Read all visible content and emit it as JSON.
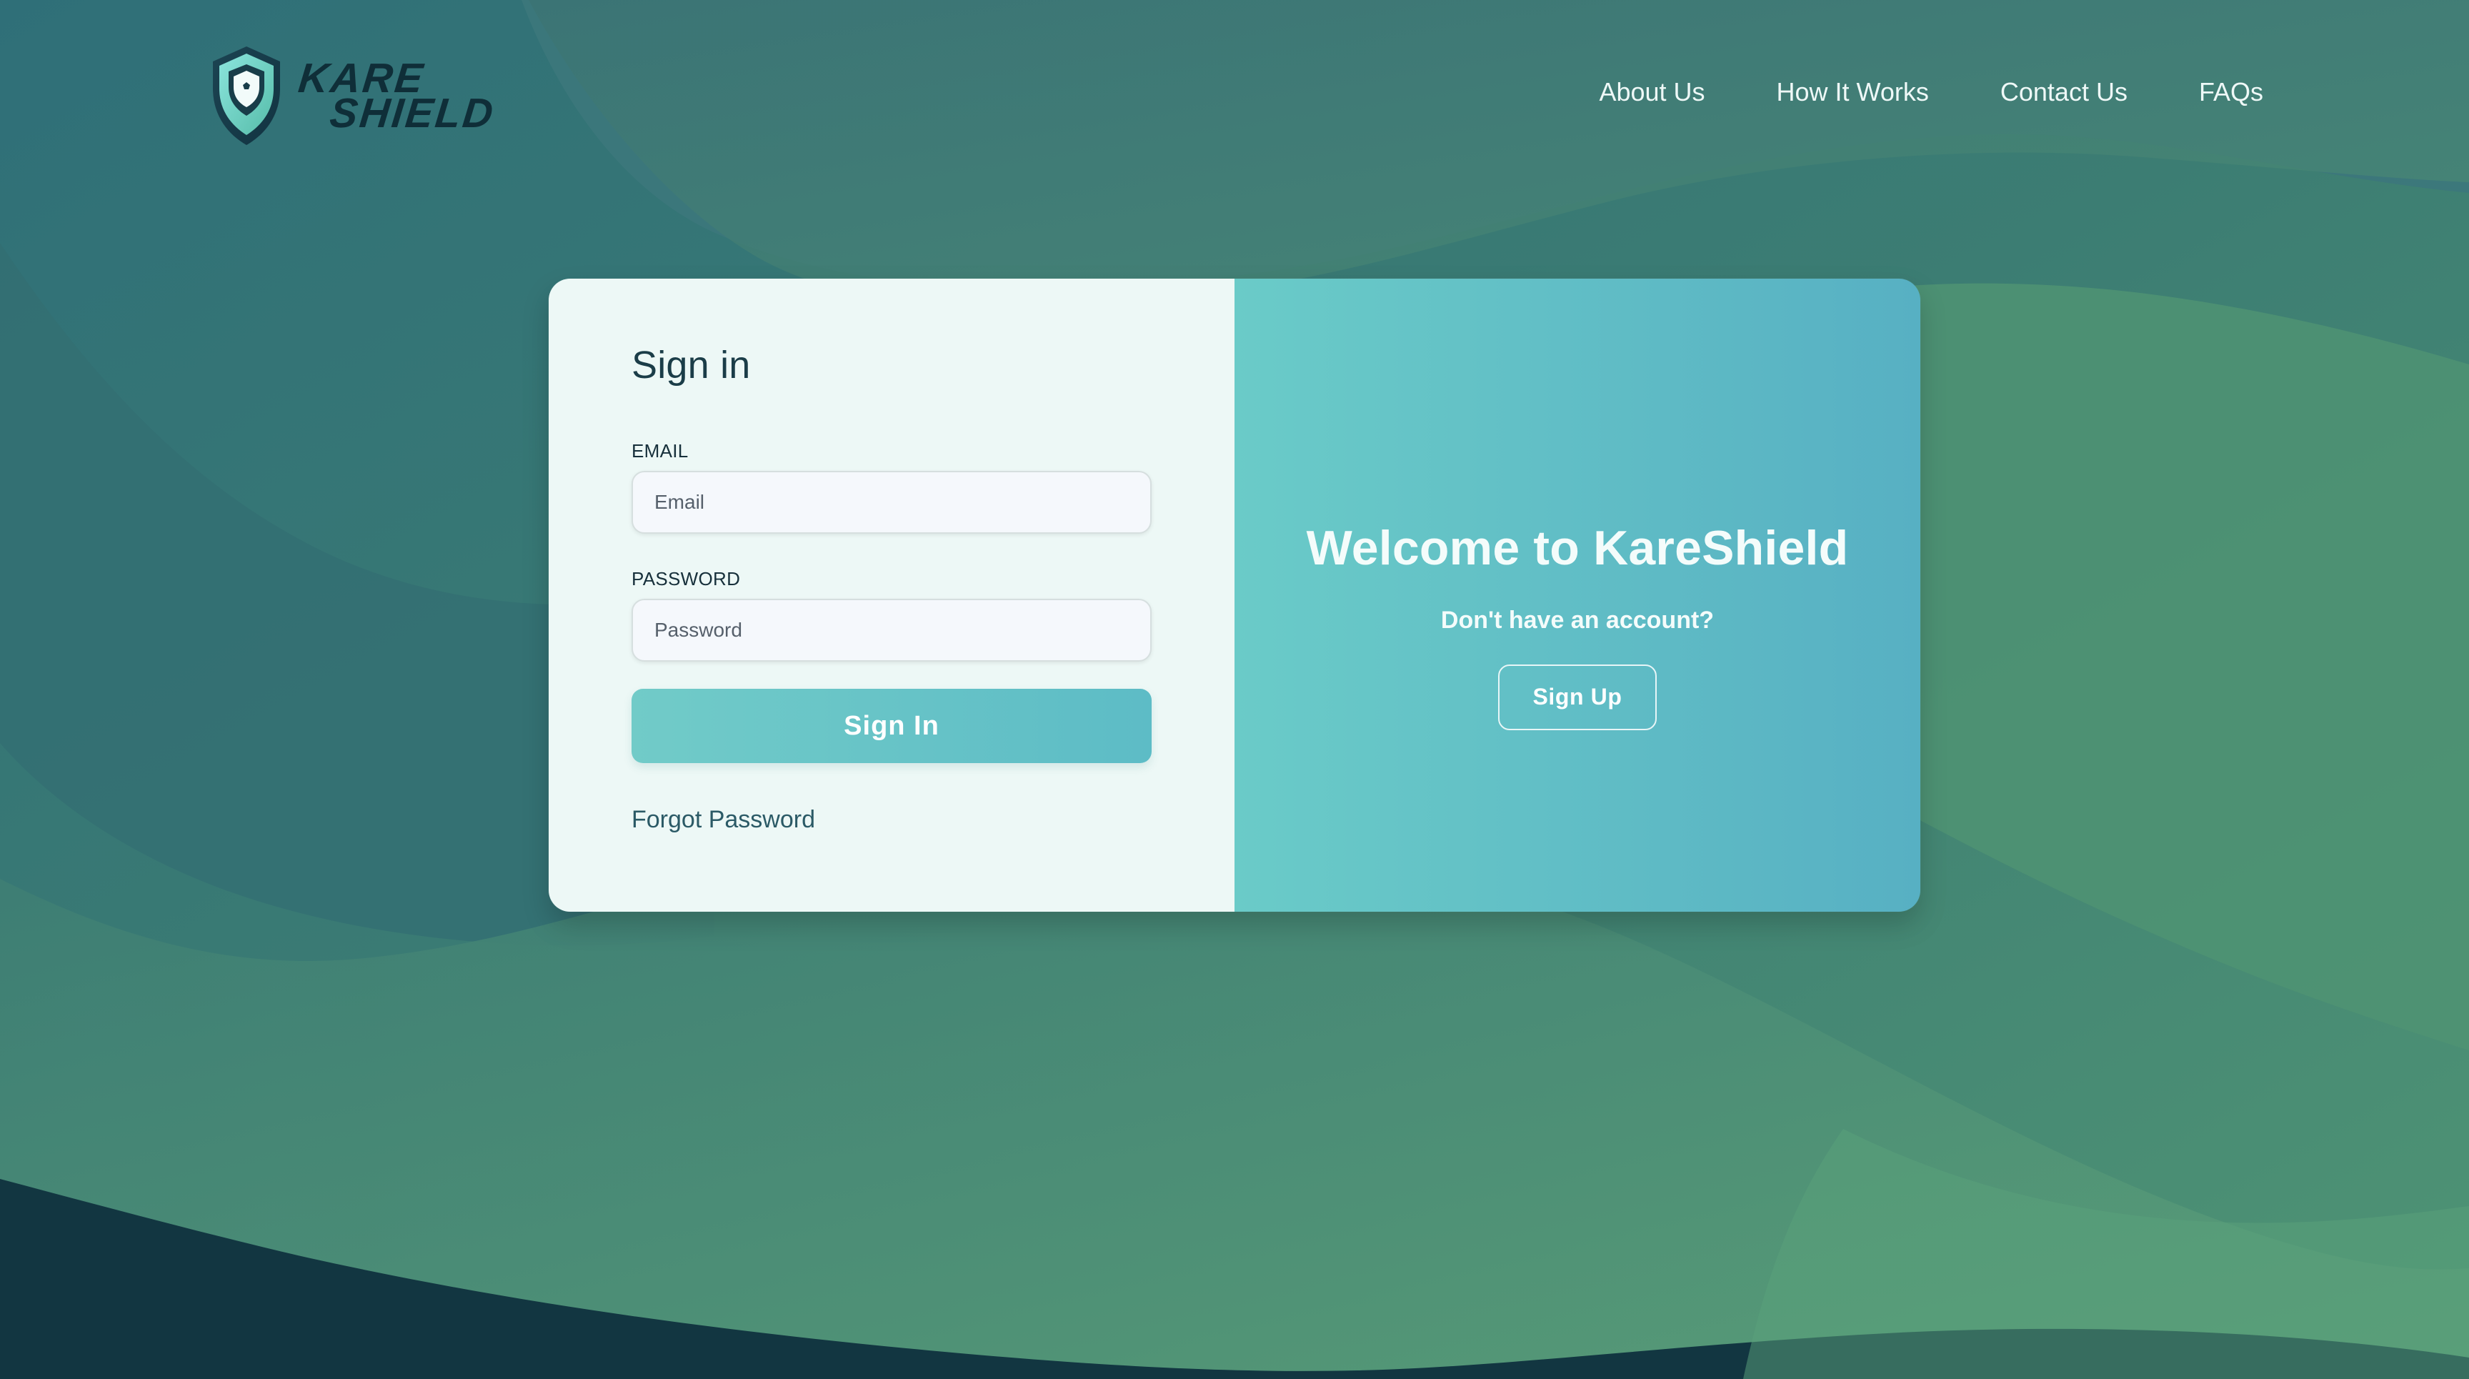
{
  "brand": {
    "name_line1": "KARE",
    "name_line2": "SHIELD",
    "shield_icon": "shield-icon",
    "colors": {
      "background": "#3f7f73",
      "card_left": "#edf8f6",
      "card_right_start": "#6acbc8",
      "card_right_end": "#57b0c3",
      "logo_dark": "#0f2e38"
    }
  },
  "nav": {
    "items": [
      {
        "label": "About Us"
      },
      {
        "label": "How It Works"
      },
      {
        "label": "Contact Us"
      },
      {
        "label": "FAQs"
      }
    ]
  },
  "signin": {
    "title": "Sign in",
    "email_label": "EMAIL",
    "email_placeholder": "Email",
    "email_value": "",
    "password_label": "PASSWORD",
    "password_placeholder": "Password",
    "password_value": "",
    "button_label": "Sign In",
    "forgot_label": "Forgot Password"
  },
  "welcome": {
    "title": "Welcome to KareShield",
    "subtitle": "Don't have an account?",
    "button_label": "Sign Up"
  }
}
